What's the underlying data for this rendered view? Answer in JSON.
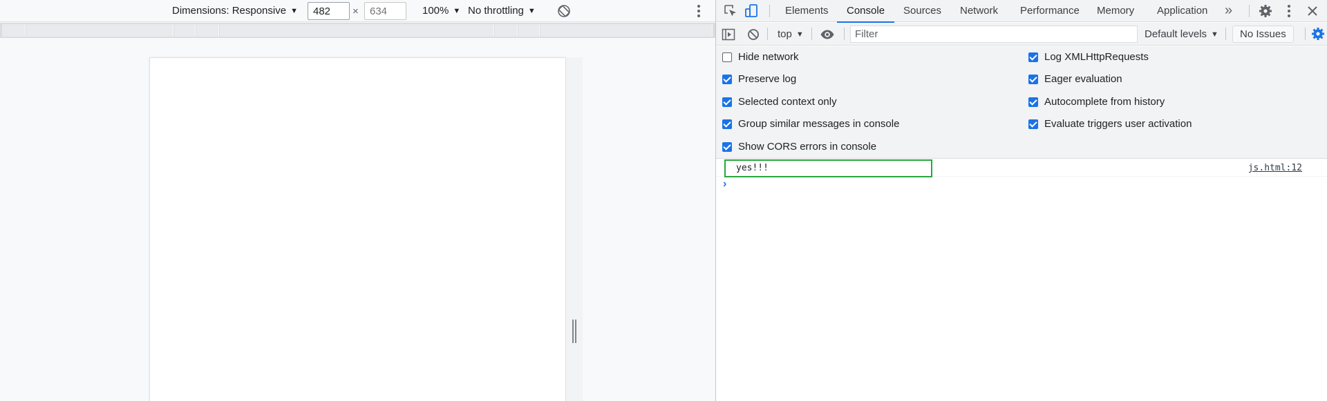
{
  "device_toolbar": {
    "dimensions_label": "Dimensions: Responsive",
    "width_value": "482",
    "height_placeholder": "634",
    "times_symbol": "×",
    "zoom_label": "100%",
    "throttling_label": "No throttling",
    "icons": [
      "rotate-icon",
      "more-vert-icon"
    ]
  },
  "devtools": {
    "tabs": [
      "Elements",
      "Console",
      "Sources",
      "Network",
      "Performance",
      "Memory",
      "Application"
    ],
    "active_tab": "Console",
    "more_tabs_label": "»",
    "icons": [
      "inspect-element-icon",
      "device-toolbar-icon",
      "settings-gear-icon",
      "more-vert-icon",
      "close-icon"
    ]
  },
  "console_toolbar": {
    "context_label": "top",
    "filter_placeholder": "Filter",
    "levels_label": "Default levels",
    "issues_label": "No Issues",
    "icons": [
      "sidebar-toggle-icon",
      "clear-console-icon",
      "eye-icon",
      "console-settings-icon"
    ]
  },
  "settings": {
    "left": [
      {
        "label": "Hide network",
        "checked": false
      },
      {
        "label": "Preserve log",
        "checked": true
      },
      {
        "label": "Selected context only",
        "checked": true
      },
      {
        "label": "Group similar messages in console",
        "checked": true
      },
      {
        "label": "Show CORS errors in console",
        "checked": true
      }
    ],
    "right": [
      {
        "label": "Log XMLHttpRequests",
        "checked": true
      },
      {
        "label": "Eager evaluation",
        "checked": true
      },
      {
        "label": "Autocomplete from history",
        "checked": true
      },
      {
        "label": "Evaluate triggers user activation",
        "checked": true
      }
    ]
  },
  "console": {
    "messages": [
      {
        "text": "yes!!!",
        "source": "js.html:12"
      }
    ],
    "prompt_symbol": "›"
  },
  "colors": {
    "accent": "#1a73e8",
    "highlight_border": "#27a73c"
  }
}
